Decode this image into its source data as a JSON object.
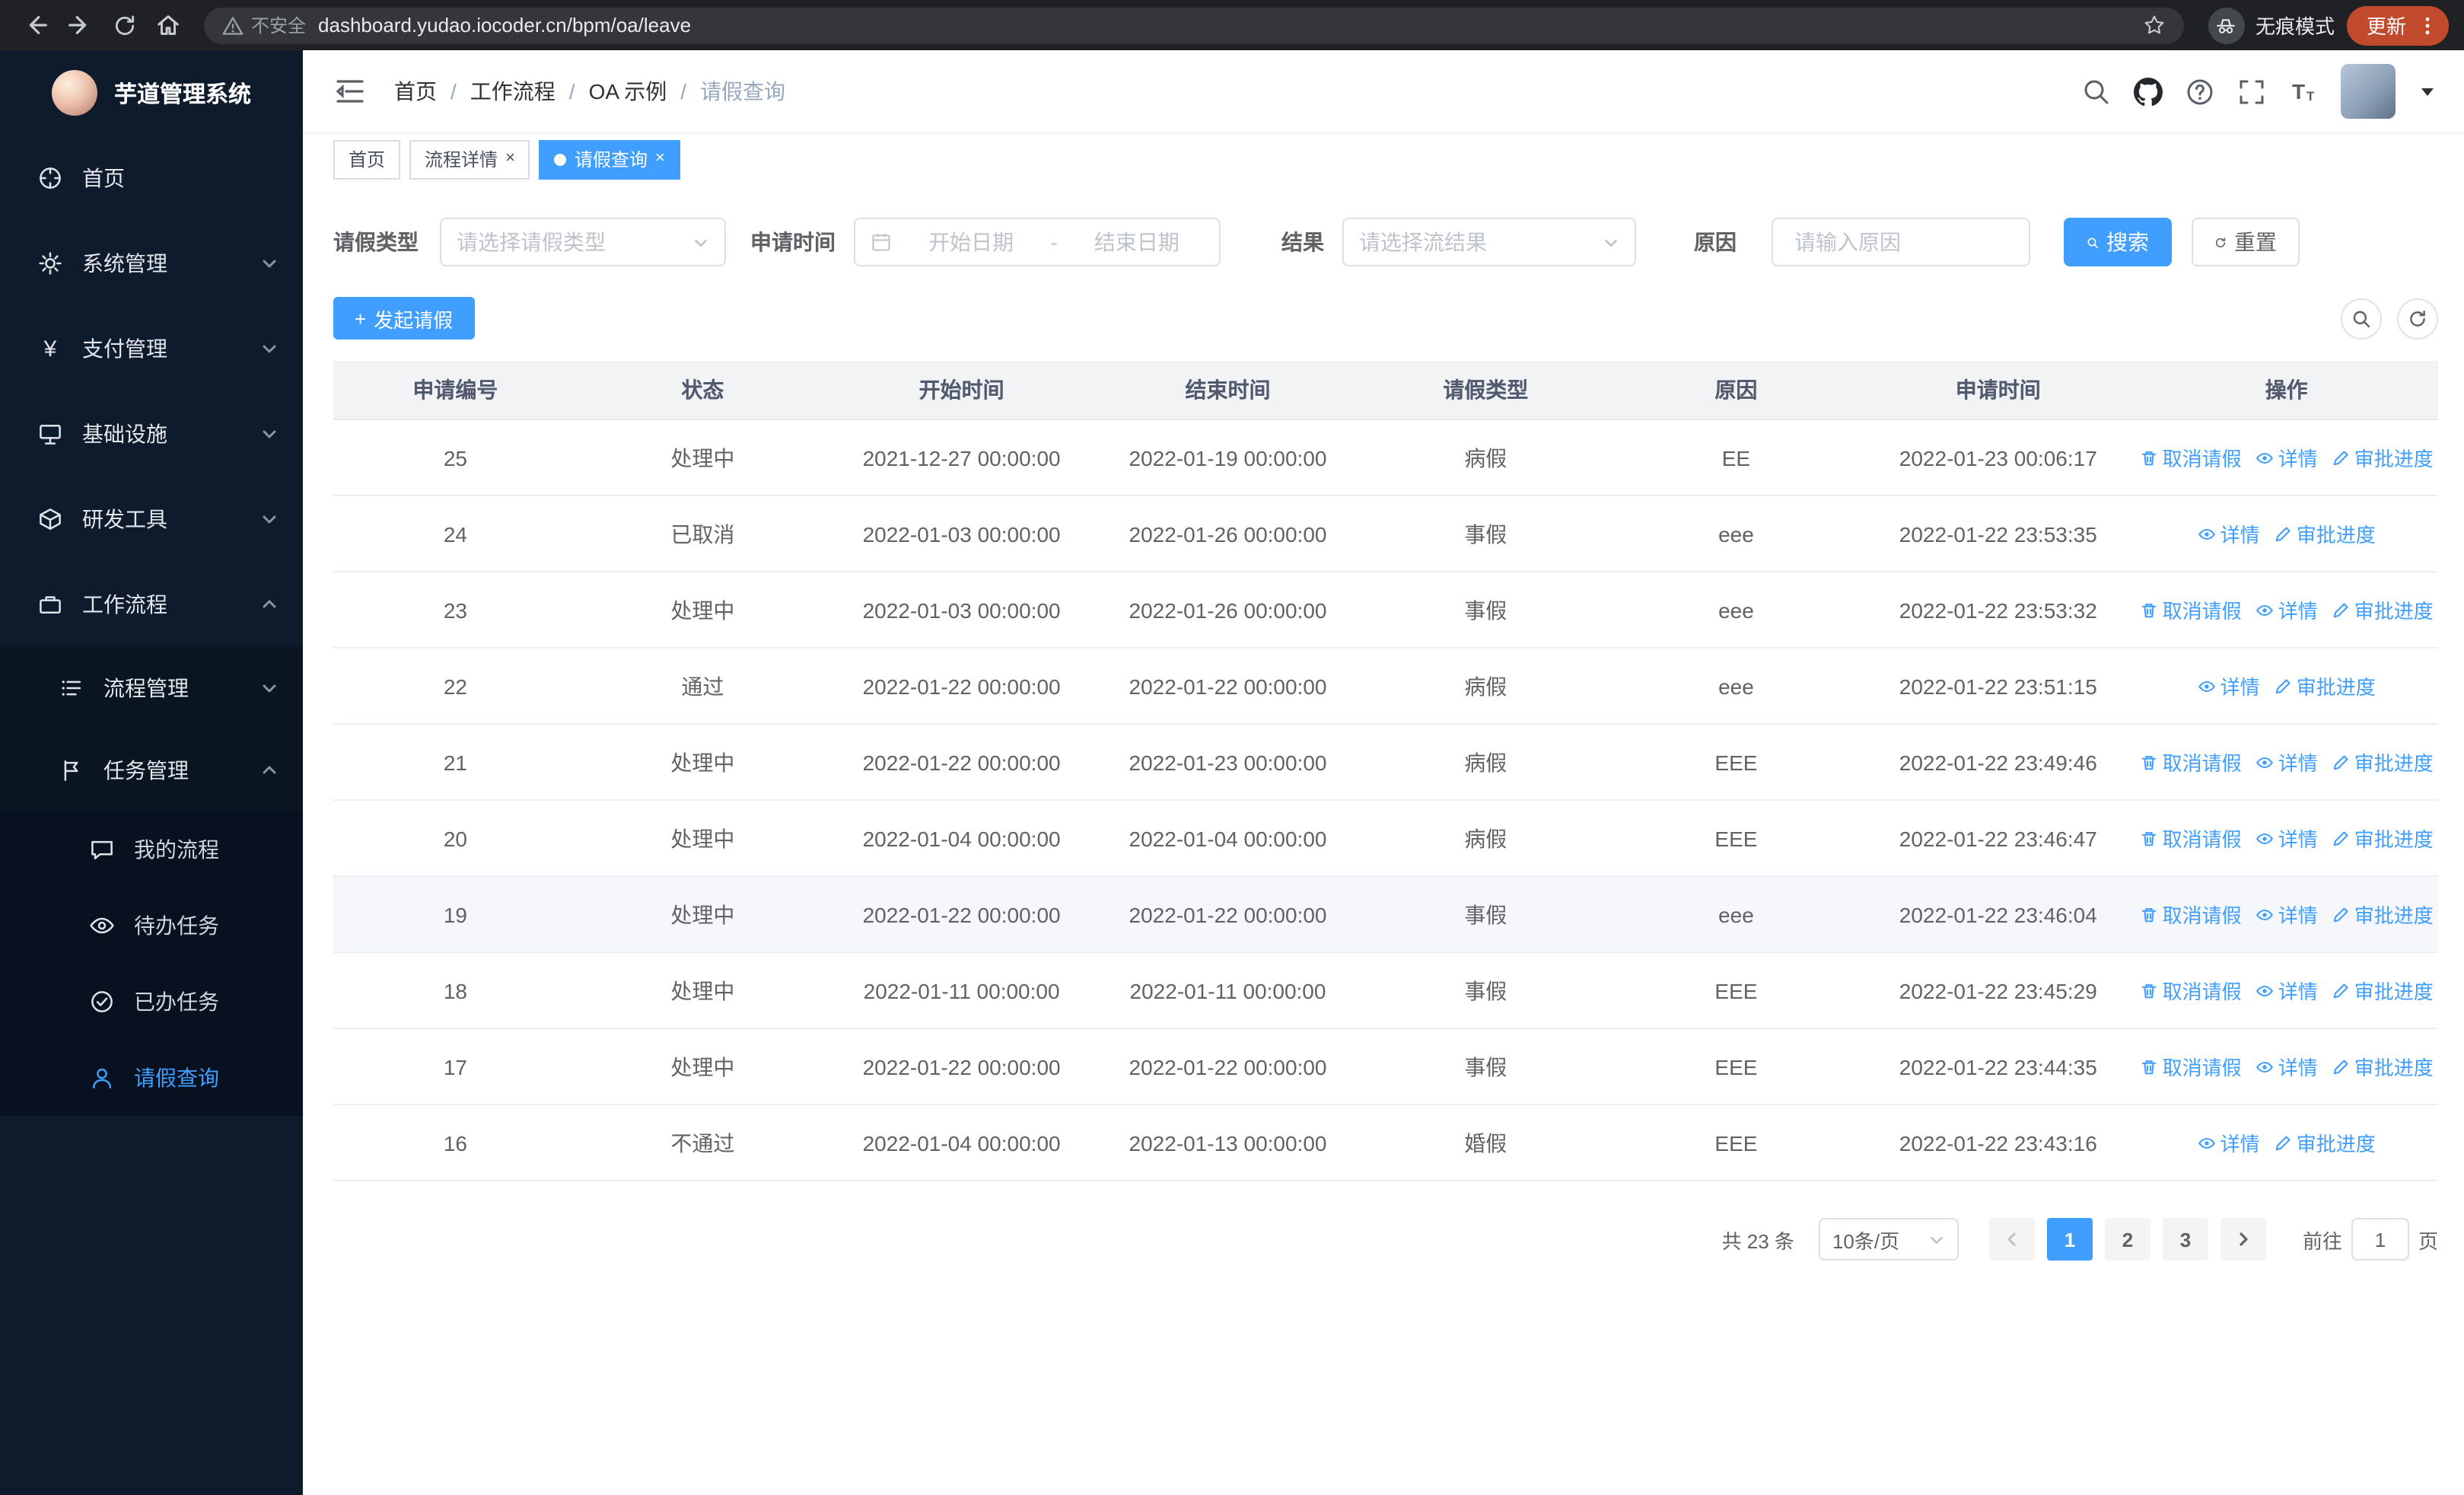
{
  "colors": {
    "accent": "#409eff",
    "sidebar_bg": "#0e1b2c",
    "chrome_bg": "#202124",
    "update_badge_bg": "#c04a2b",
    "table_header_bg": "#f2f3f5"
  },
  "icons": {
    "close": "×",
    "plus": "+",
    "range_sep": "-"
  },
  "browser": {
    "security_warning": "不安全",
    "url": "dashboard.yudao.iocoder.cn/bpm/oa/leave",
    "incognito_label": "无痕模式",
    "update_button": "更新"
  },
  "sidebar": {
    "logo_title": "芋道管理系统",
    "items": [
      {
        "icon": "dashboard-icon",
        "label": "首页"
      },
      {
        "icon": "gear-icon",
        "label": "系统管理"
      },
      {
        "icon": "yen-icon",
        "label": "支付管理"
      },
      {
        "icon": "infrastructure-icon",
        "label": "基础设施"
      },
      {
        "icon": "dev-tools-icon",
        "label": "研发工具"
      },
      {
        "icon": "workflow-icon",
        "label": "工作流程"
      },
      {
        "icon": "process-icon",
        "label": "流程管理"
      },
      {
        "icon": "task-icon",
        "label": "任务管理"
      },
      {
        "icon": "chat-icon",
        "label": "我的流程"
      },
      {
        "icon": "eye-icon",
        "label": "待办任务"
      },
      {
        "icon": "done-icon",
        "label": "已办任务"
      },
      {
        "icon": "user-icon",
        "label": "请假查询",
        "active": true
      }
    ]
  },
  "header": {
    "breadcrumb": [
      {
        "label": "首页"
      },
      {
        "label": "工作流程"
      },
      {
        "label": "OA 示例"
      },
      {
        "label": "请假查询",
        "current": true
      }
    ],
    "separator": "/"
  },
  "tabs": [
    {
      "label": "首页",
      "closable": false,
      "active": false
    },
    {
      "label": "流程详情",
      "closable": true,
      "active": false
    },
    {
      "label": "请假查询",
      "closable": true,
      "active": true
    }
  ],
  "filters": {
    "leave_type_label": "请假类型",
    "leave_type_placeholder": "请选择请假类型",
    "apply_time_label": "申请时间",
    "start_date_placeholder": "开始日期",
    "range_separator": "-",
    "end_date_placeholder": "结束日期",
    "result_label": "结果",
    "result_placeholder": "请选择流结果",
    "reason_label": "原因",
    "reason_placeholder": "请输入原因",
    "search_button": "搜索",
    "reset_button": "重置"
  },
  "toolbar": {
    "create_button": "发起请假"
  },
  "table": {
    "columns": [
      "申请编号",
      "状态",
      "开始时间",
      "结束时间",
      "请假类型",
      "原因",
      "申请时间",
      "操作"
    ],
    "actions": {
      "cancel": "取消请假",
      "detail": "详情",
      "progress": "审批进度"
    },
    "rows": [
      {
        "id": "25",
        "status": "处理中",
        "start": "2021-12-27 00:00:00",
        "end": "2022-01-19 00:00:00",
        "type": "病假",
        "reason": "EE",
        "apply_time": "2022-01-23 00:06:17",
        "can_cancel": true,
        "highlighted": false
      },
      {
        "id": "24",
        "status": "已取消",
        "start": "2022-01-03 00:00:00",
        "end": "2022-01-26 00:00:00",
        "type": "事假",
        "reason": "eee",
        "apply_time": "2022-01-22 23:53:35",
        "can_cancel": false,
        "highlighted": false
      },
      {
        "id": "23",
        "status": "处理中",
        "start": "2022-01-03 00:00:00",
        "end": "2022-01-26 00:00:00",
        "type": "事假",
        "reason": "eee",
        "apply_time": "2022-01-22 23:53:32",
        "can_cancel": true,
        "highlighted": false
      },
      {
        "id": "22",
        "status": "通过",
        "start": "2022-01-22 00:00:00",
        "end": "2022-01-22 00:00:00",
        "type": "病假",
        "reason": "eee",
        "apply_time": "2022-01-22 23:51:15",
        "can_cancel": false,
        "highlighted": false
      },
      {
        "id": "21",
        "status": "处理中",
        "start": "2022-01-22 00:00:00",
        "end": "2022-01-23 00:00:00",
        "type": "病假",
        "reason": "EEE",
        "apply_time": "2022-01-22 23:49:46",
        "can_cancel": true,
        "highlighted": false
      },
      {
        "id": "20",
        "status": "处理中",
        "start": "2022-01-04 00:00:00",
        "end": "2022-01-04 00:00:00",
        "type": "病假",
        "reason": "EEE",
        "apply_time": "2022-01-22 23:46:47",
        "can_cancel": true,
        "highlighted": false
      },
      {
        "id": "19",
        "status": "处理中",
        "start": "2022-01-22 00:00:00",
        "end": "2022-01-22 00:00:00",
        "type": "事假",
        "reason": "eee",
        "apply_time": "2022-01-22 23:46:04",
        "can_cancel": true,
        "highlighted": true
      },
      {
        "id": "18",
        "status": "处理中",
        "start": "2022-01-11 00:00:00",
        "end": "2022-01-11 00:00:00",
        "type": "事假",
        "reason": "EEE",
        "apply_time": "2022-01-22 23:45:29",
        "can_cancel": true,
        "highlighted": false
      },
      {
        "id": "17",
        "status": "处理中",
        "start": "2022-01-22 00:00:00",
        "end": "2022-01-22 00:00:00",
        "type": "事假",
        "reason": "EEE",
        "apply_time": "2022-01-22 23:44:35",
        "can_cancel": true,
        "highlighted": false
      },
      {
        "id": "16",
        "status": "不通过",
        "start": "2022-01-04 00:00:00",
        "end": "2022-01-13 00:00:00",
        "type": "婚假",
        "reason": "EEE",
        "apply_time": "2022-01-22 23:43:16",
        "can_cancel": false,
        "highlighted": false
      }
    ]
  },
  "pagination": {
    "total": "共 23 条",
    "page_size": "10条/页",
    "pages": [
      "1",
      "2",
      "3"
    ],
    "active_page": "1",
    "goto_label": "前往",
    "goto_value": "1",
    "page_unit": "页"
  }
}
